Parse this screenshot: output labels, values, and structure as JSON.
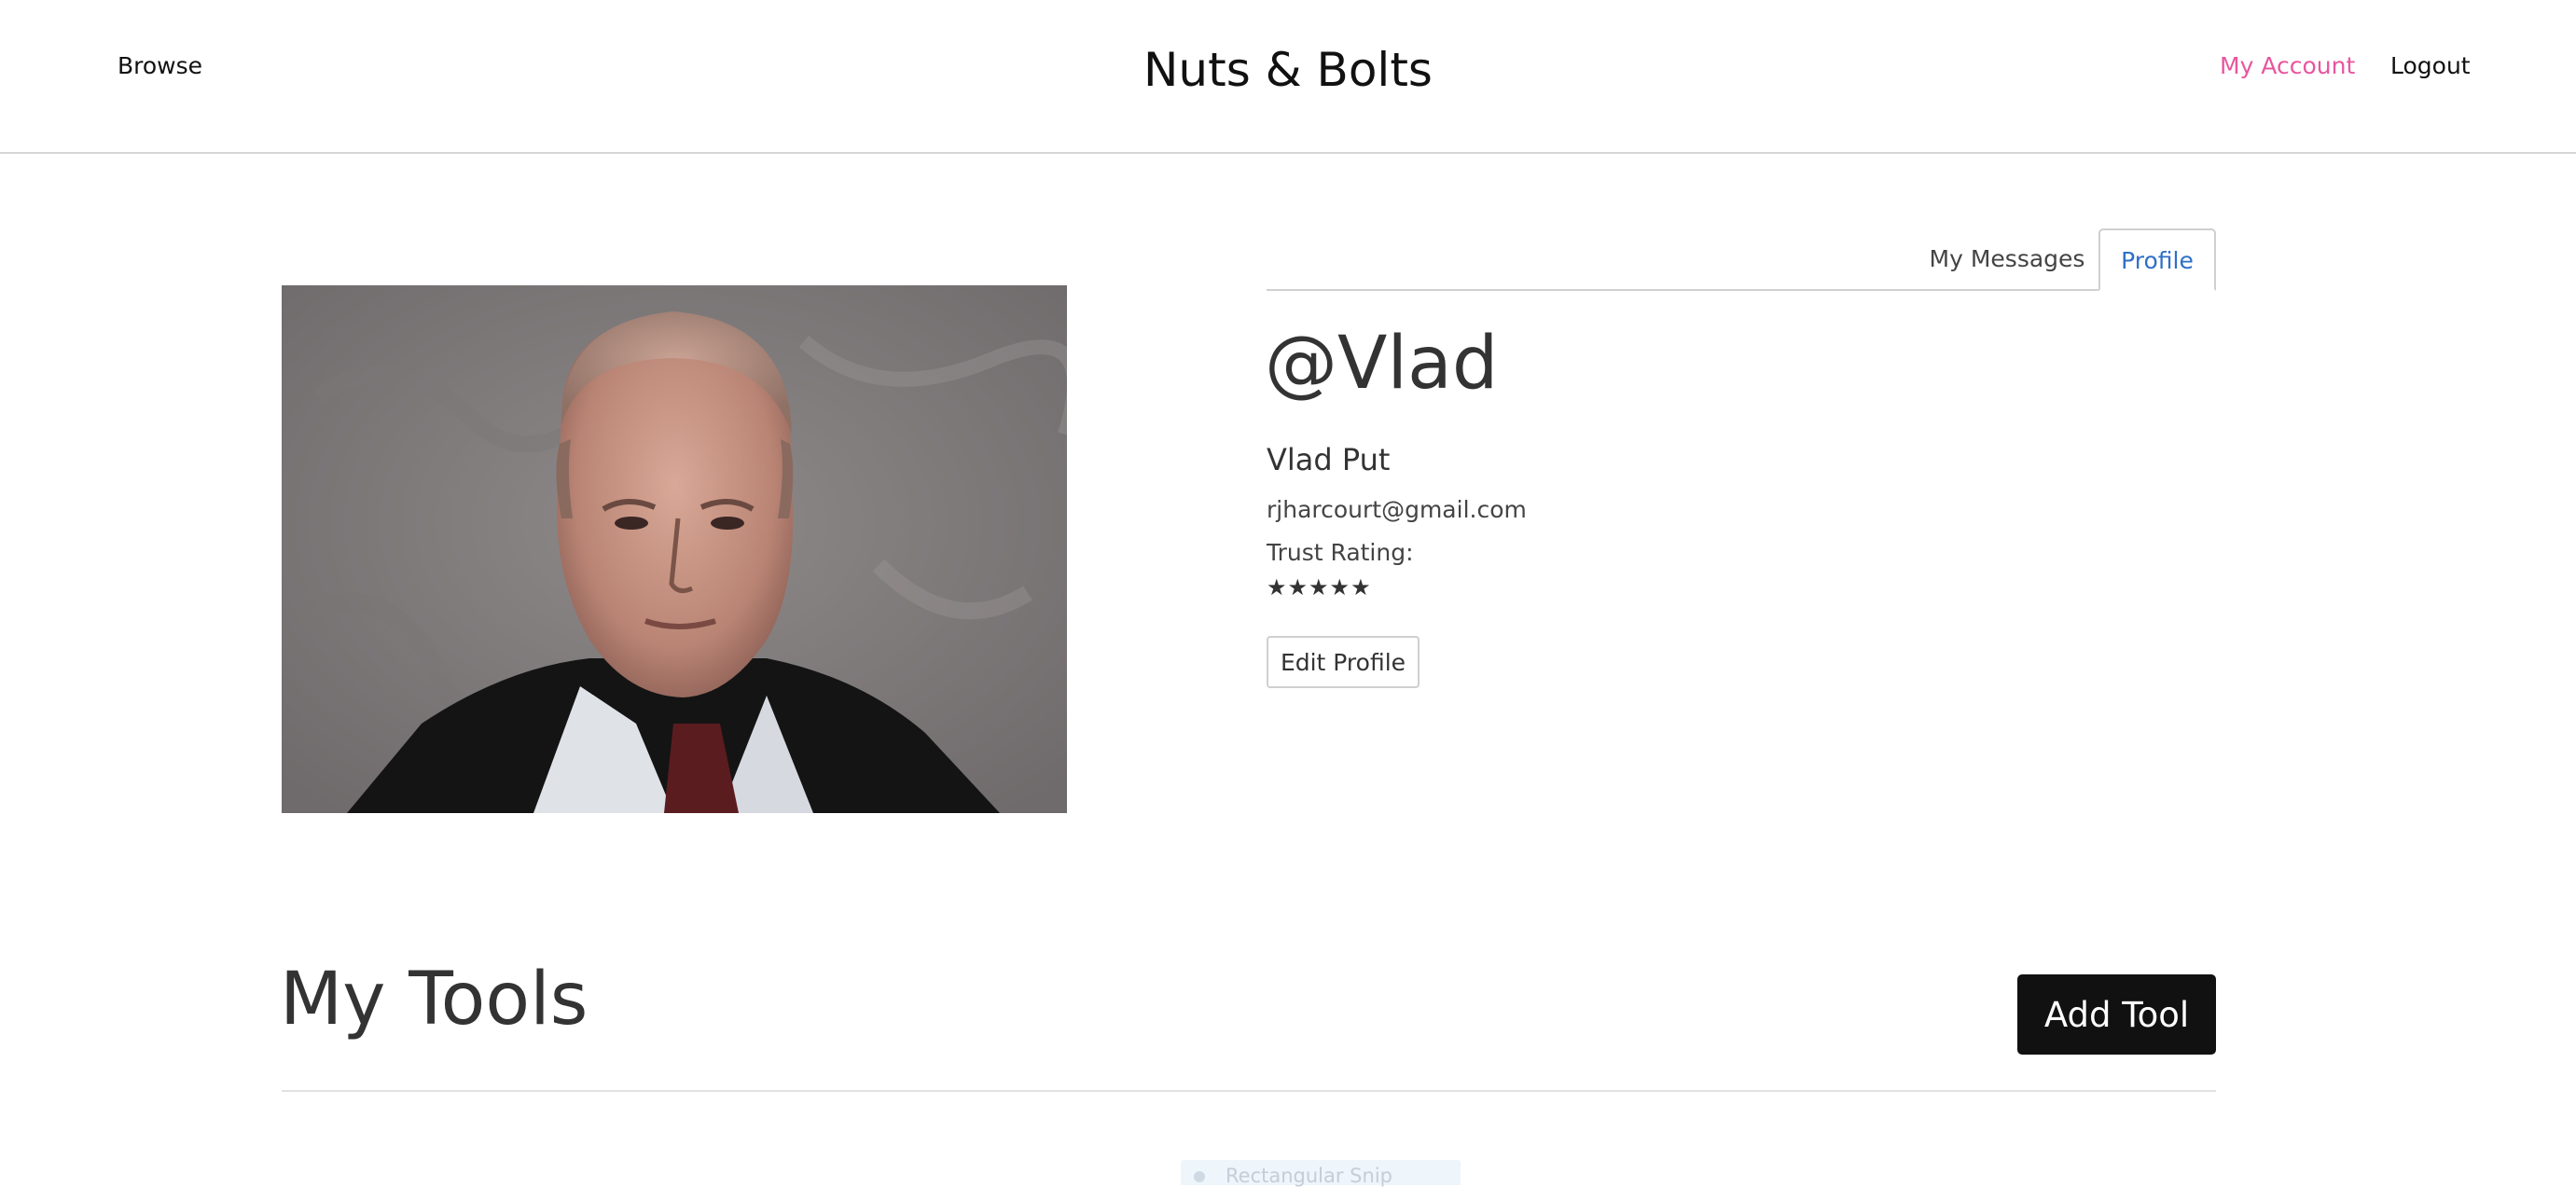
{
  "header": {
    "brand": "Nuts & Bolts",
    "browse_label": "Browse",
    "account_label": "My Account",
    "logout_label": "Logout",
    "account_color": "#e8559f"
  },
  "tabs": [
    {
      "label": "My Messages",
      "active": false
    },
    {
      "label": "Profile",
      "active": true
    }
  ],
  "profile": {
    "handle": "@Vlad",
    "full_name": "Vlad Put",
    "email": "rjharcourt@gmail.com",
    "trust_label": "Trust Rating:",
    "stars": "★★★★★",
    "trust_rating": 5,
    "edit_label": "Edit Profile"
  },
  "tools": {
    "title": "My Tools",
    "add_label": "Add Tool"
  },
  "overlay": {
    "snip_label": "Rectangular Snip"
  }
}
